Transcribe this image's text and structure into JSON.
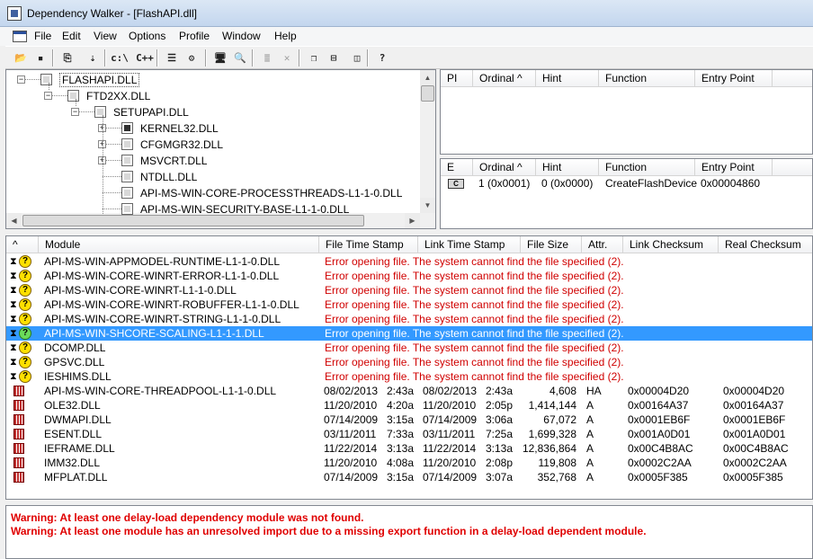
{
  "window": {
    "title": "Dependency Walker - [FlashAPI.dll]"
  },
  "menu": [
    "File",
    "Edit",
    "View",
    "Options",
    "Profile",
    "Window",
    "Help"
  ],
  "toolbar": [
    {
      "name": "open-icon",
      "glyph": "📂"
    },
    {
      "name": "save-icon",
      "glyph": "▪"
    },
    {
      "name": "copy-icon",
      "glyph": "⎘"
    },
    {
      "name": "expand-icon",
      "glyph": "⇣"
    },
    {
      "name": "full-paths-button",
      "glyph": "c:\\"
    },
    {
      "name": "undecorate-button",
      "glyph": "C++"
    },
    {
      "name": "properties-icon",
      "glyph": "☰"
    },
    {
      "name": "configure-icon",
      "glyph": "⚙"
    },
    {
      "name": "system-info-icon",
      "glyph": "🖥"
    },
    {
      "name": "find-icon",
      "glyph": "🔍"
    },
    {
      "name": "highlight-match-icon",
      "glyph": "≣",
      "disabled": true
    },
    {
      "name": "next-icon",
      "glyph": "✕",
      "disabled": true
    },
    {
      "name": "cascade-icon",
      "glyph": "❐"
    },
    {
      "name": "tile-horizontal-icon",
      "glyph": "⊟"
    },
    {
      "name": "tile-vertical-icon",
      "glyph": "◫"
    },
    {
      "name": "help-icon",
      "glyph": "?"
    }
  ],
  "tree": [
    {
      "label": "FLASHAPI.DLL",
      "level": 0,
      "expander": "−",
      "selected": true
    },
    {
      "label": "FTD2XX.DLL",
      "level": 1,
      "expander": "−"
    },
    {
      "label": "SETUPAPI.DLL",
      "level": 2,
      "expander": "−"
    },
    {
      "label": "KERNEL32.DLL",
      "level": 3,
      "expander": "+",
      "kind": "kern"
    },
    {
      "label": "CFGMGR32.DLL",
      "level": 3,
      "expander": "+"
    },
    {
      "label": "MSVCRT.DLL",
      "level": 3,
      "expander": "+"
    },
    {
      "label": "NTDLL.DLL",
      "level": 3,
      "expander": ""
    },
    {
      "label": "API-MS-WIN-CORE-PROCESSTHREADS-L1-1-0.DLL",
      "level": 3,
      "expander": ""
    },
    {
      "label": "API-MS-WIN-SECURITY-BASE-L1-1-0.DLL",
      "level": 3,
      "expander": ""
    }
  ],
  "imports": {
    "headers": [
      "PI",
      "Ordinal ^",
      "Hint",
      "Function",
      "Entry Point"
    ]
  },
  "exports": {
    "headers": [
      "E",
      "Ordinal ^",
      "Hint",
      "Function",
      "Entry Point"
    ],
    "rows": [
      {
        "icon": "C",
        "ordinal": "1 (0x0001)",
        "hint": "0 (0x0000)",
        "function": "CreateFlashDevice",
        "entry": "0x00004860"
      }
    ]
  },
  "modules": {
    "headers": [
      "^",
      "Module",
      "File Time Stamp",
      "Link Time Stamp",
      "File Size",
      "Attr.",
      "Link Checksum",
      "Real Checksum"
    ],
    "rows": [
      {
        "icon": "missing",
        "module": "API-MS-WIN-APPMODEL-RUNTIME-L1-1-0.DLL",
        "error": "Error opening file. The system cannot find the file specified (2)."
      },
      {
        "icon": "missing",
        "module": "API-MS-WIN-CORE-WINRT-ERROR-L1-1-0.DLL",
        "error": "Error opening file. The system cannot find the file specified (2)."
      },
      {
        "icon": "missing",
        "module": "API-MS-WIN-CORE-WINRT-L1-1-0.DLL",
        "error": "Error opening file. The system cannot find the file specified (2)."
      },
      {
        "icon": "missing",
        "module": "API-MS-WIN-CORE-WINRT-ROBUFFER-L1-1-0.DLL",
        "error": "Error opening file. The system cannot find the file specified (2)."
      },
      {
        "icon": "missing",
        "module": "API-MS-WIN-CORE-WINRT-STRING-L1-1-0.DLL",
        "error": "Error opening file. The system cannot find the file specified (2)."
      },
      {
        "icon": "missing-sel",
        "module": "API-MS-WIN-SHCORE-SCALING-L1-1-1.DLL",
        "error": "Error opening file. The system cannot find the file specified (2).",
        "selected": true
      },
      {
        "icon": "missing",
        "module": "DCOMP.DLL",
        "error": "Error opening file. The system cannot find the file specified (2)."
      },
      {
        "icon": "missing",
        "module": "GPSVC.DLL",
        "error": "Error opening file. The system cannot find the file specified (2)."
      },
      {
        "icon": "missing",
        "module": "IESHIMS.DLL",
        "error": "Error opening file. The system cannot find the file specified (2)."
      },
      {
        "icon": "module",
        "module": "API-MS-WIN-CORE-THREADPOOL-L1-1-0.DLL",
        "fdate": "08/02/2013",
        "ftime": "2:43a",
        "ldate": "08/02/2013",
        "ltime": "2:43a",
        "size": "4,608",
        "attr": "HA",
        "lcs": "0x00004D20",
        "rcs": "0x00004D20"
      },
      {
        "icon": "module",
        "module": "OLE32.DLL",
        "fdate": "11/20/2010",
        "ftime": "4:20a",
        "ldate": "11/20/2010",
        "ltime": "2:05p",
        "size": "1,414,144",
        "attr": "A",
        "lcs": "0x00164A37",
        "rcs": "0x00164A37"
      },
      {
        "icon": "module",
        "module": "DWMAPI.DLL",
        "fdate": "07/14/2009",
        "ftime": "3:15a",
        "ldate": "07/14/2009",
        "ltime": "3:06a",
        "size": "67,072",
        "attr": "A",
        "lcs": "0x0001EB6F",
        "rcs": "0x0001EB6F"
      },
      {
        "icon": "module",
        "module": "ESENT.DLL",
        "fdate": "03/11/2011",
        "ftime": "7:33a",
        "ldate": "03/11/2011",
        "ltime": "7:25a",
        "size": "1,699,328",
        "attr": "A",
        "lcs": "0x001A0D01",
        "rcs": "0x001A0D01"
      },
      {
        "icon": "module",
        "module": "IEFRAME.DLL",
        "fdate": "11/22/2014",
        "ftime": "3:13a",
        "ldate": "11/22/2014",
        "ltime": "3:13a",
        "size": "12,836,864",
        "attr": "A",
        "lcs": "0x00C4B8AC",
        "rcs": "0x00C4B8AC"
      },
      {
        "icon": "module",
        "module": "IMM32.DLL",
        "fdate": "11/20/2010",
        "ftime": "4:08a",
        "ldate": "11/20/2010",
        "ltime": "2:08p",
        "size": "119,808",
        "attr": "A",
        "lcs": "0x0002C2AA",
        "rcs": "0x0002C2AA"
      },
      {
        "icon": "module",
        "module": "MFPLAT.DLL",
        "fdate": "07/14/2009",
        "ftime": "3:15a",
        "ldate": "07/14/2009",
        "ltime": "3:07a",
        "size": "352,768",
        "attr": "A",
        "lcs": "0x0005F385",
        "rcs": "0x0005F385"
      }
    ]
  },
  "log": [
    "Warning: At least one delay-load dependency module was not found.",
    "Warning: At least one module has an unresolved import due to a missing export function in a delay-load dependent module."
  ],
  "colors": {
    "error": "#d00000",
    "selection": "#3399ff",
    "warning": "#e00000"
  }
}
